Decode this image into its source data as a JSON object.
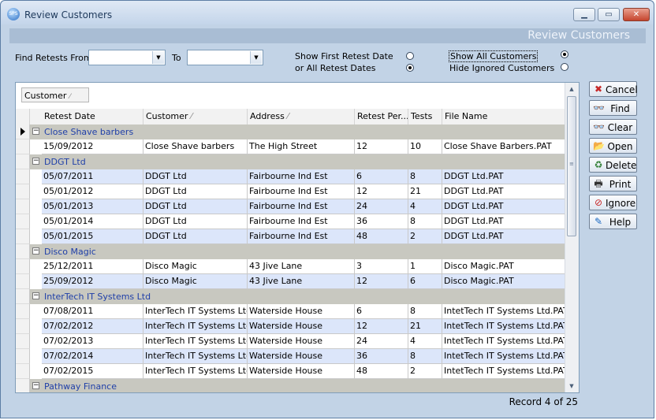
{
  "window": {
    "title": "Review Customers",
    "header_band": "Review Customers",
    "app_icon_text": "SPS"
  },
  "filters": {
    "find_from_label": "Find Retests From",
    "to_label": "To",
    "from_value": "",
    "to_value": "",
    "show_first_label": "Show First Retest Date",
    "all_retest_label": "or All Retest Dates",
    "show_all_customers_label": "Show All Customers",
    "hide_ignored_label": "Hide Ignored Customers"
  },
  "grid": {
    "group_chip": "Customer",
    "columns": [
      "Retest Date",
      "Customer",
      "Address",
      "Retest Per...",
      "Tests",
      "File Name"
    ],
    "groups": [
      {
        "name": "Close Shave barbers",
        "rows": [
          [
            "15/09/2012",
            "Close Shave barbers",
            "The High Street",
            "12",
            "10",
            "Close Shave Barbers.PAT"
          ]
        ]
      },
      {
        "name": "DDGT Ltd",
        "rows": [
          [
            "05/07/2011",
            "DDGT Ltd",
            "Fairbourne Ind Est",
            "6",
            "8",
            "DDGT Ltd.PAT"
          ],
          [
            "05/01/2012",
            "DDGT Ltd",
            "Fairbourne Ind Est",
            "12",
            "21",
            "DDGT Ltd.PAT"
          ],
          [
            "05/01/2013",
            "DDGT Ltd",
            "Fairbourne Ind Est",
            "24",
            "4",
            "DDGT Ltd.PAT"
          ],
          [
            "05/01/2014",
            "DDGT Ltd",
            "Fairbourne Ind Est",
            "36",
            "8",
            "DDGT Ltd.PAT"
          ],
          [
            "05/01/2015",
            "DDGT Ltd",
            "Fairbourne Ind Est",
            "48",
            "2",
            "DDGT Ltd.PAT"
          ]
        ]
      },
      {
        "name": "Disco Magic",
        "rows": [
          [
            "25/12/2011",
            "Disco Magic",
            "43 Jive Lane",
            "3",
            "1",
            "Disco Magic.PAT"
          ],
          [
            "25/09/2012",
            "Disco Magic",
            "43 Jive Lane",
            "12",
            "6",
            "Disco Magic.PAT"
          ]
        ]
      },
      {
        "name": "InterTech IT Systems Ltd",
        "rows": [
          [
            "07/08/2011",
            "InterTech IT Systems Ltd",
            "Waterside House",
            "6",
            "8",
            "IntetTech IT Systems Ltd.PAT"
          ],
          [
            "07/02/2012",
            "InterTech IT Systems Ltd",
            "Waterside House",
            "12",
            "21",
            "IntetTech IT Systems Ltd.PAT"
          ],
          [
            "07/02/2013",
            "InterTech IT Systems Ltd",
            "Waterside House",
            "24",
            "4",
            "IntetTech IT Systems Ltd.PAT"
          ],
          [
            "07/02/2014",
            "InterTech IT Systems Ltd",
            "Waterside House",
            "36",
            "8",
            "IntetTech IT Systems Ltd.PAT"
          ],
          [
            "07/02/2015",
            "InterTech IT Systems Ltd",
            "Waterside House",
            "48",
            "2",
            "IntetTech IT Systems Ltd.PAT"
          ]
        ]
      },
      {
        "name": "Pathway Finance",
        "rows": []
      }
    ]
  },
  "buttons": [
    {
      "name": "cancel-button",
      "label": "Cancel",
      "icon": "x-icon",
      "glyph": "✖",
      "color": "#c62828"
    },
    {
      "name": "find-button",
      "label": "Find",
      "icon": "binoculars-icon",
      "glyph": "👓",
      "color": "#222222"
    },
    {
      "name": "clear-button",
      "label": "Clear",
      "icon": "binoculars-clear-icon",
      "glyph": "👓",
      "color": "#222222"
    },
    {
      "name": "open-button",
      "label": "Open",
      "icon": "folder-open-icon",
      "glyph": "📂",
      "color": "#b8860b"
    },
    {
      "name": "delete-button",
      "label": "Delete",
      "icon": "recycle-bin-icon",
      "glyph": "♻",
      "color": "#2e7d32"
    },
    {
      "name": "print-button",
      "label": "Print",
      "icon": "printer-icon",
      "glyph": "🖶",
      "color": "#333333"
    },
    {
      "name": "ignore-button",
      "label": "Ignore",
      "icon": "no-entry-icon",
      "glyph": "⊘",
      "color": "#c62828"
    },
    {
      "name": "help-button",
      "label": "Help",
      "icon": "help-book-icon",
      "glyph": "✎",
      "color": "#1565c0"
    }
  ],
  "status": {
    "record": "Record 4 of 25"
  }
}
